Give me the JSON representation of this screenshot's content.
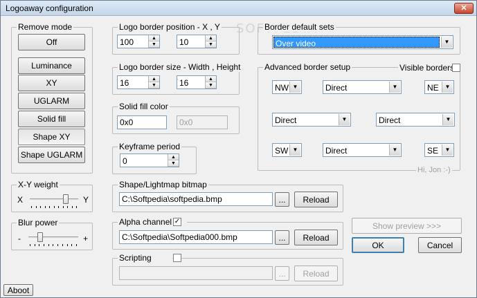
{
  "window": {
    "title": "Logoaway configuration",
    "close_glyph": "✕"
  },
  "watermark": "SOFTPEDIA",
  "remove_mode": {
    "legend": "Remove mode",
    "buttons": [
      "Off",
      "Luminance",
      "XY",
      "UGLARM",
      "Solid fill",
      "Shape XY",
      "Shape UGLARM"
    ],
    "pressed": "Shape XY"
  },
  "xy_weight": {
    "legend": "X-Y weight",
    "left_label": "X",
    "right_label": "Y",
    "level": 0.78
  },
  "blur_power": {
    "legend": "Blur power",
    "left_label": "-",
    "right_label": "+",
    "level": 0.2
  },
  "logo_position": {
    "legend": "Logo border position - X , Y",
    "x": "100",
    "y": "10"
  },
  "logo_size": {
    "legend": "Logo border size - Width , Height",
    "width": "16",
    "height": "16"
  },
  "solid_fill": {
    "legend": "Solid fill color",
    "value": "0x0",
    "value_disabled": "0x0"
  },
  "keyframe": {
    "legend": "Keyframe period",
    "value": "0"
  },
  "shape_bitmap": {
    "legend": "Shape/Lightmap bitmap",
    "path": "C:\\Softpedia\\softpedia.bmp",
    "browse": "...",
    "reload": "Reload"
  },
  "alpha_channel": {
    "legend": "Alpha channel",
    "checked": "✓",
    "path": "C:\\Softpedia\\Softpedia000.bmp",
    "browse": "...",
    "reload": "Reload"
  },
  "scripting": {
    "legend": "Scripting",
    "path": "",
    "browse": "...",
    "reload": "Reload"
  },
  "border_defaults": {
    "legend": "Border default sets",
    "selected": "Over video"
  },
  "advanced": {
    "legend": "Advanced border setup",
    "visible_borders_label": "Visible borders",
    "nw": "NW",
    "ne": "NE",
    "sw": "SW",
    "se": "SE",
    "top": "Direct",
    "left": "Direct",
    "right": "Direct",
    "bottom": "Direct",
    "footer": "Hi, Jon :-)"
  },
  "buttons": {
    "show_preview": "Show preview >>>",
    "ok": "OK",
    "cancel": "Cancel",
    "about": "Aboot"
  },
  "icons": {
    "dropdown": "▼",
    "spin_up": "▲",
    "spin_down": "▼"
  }
}
